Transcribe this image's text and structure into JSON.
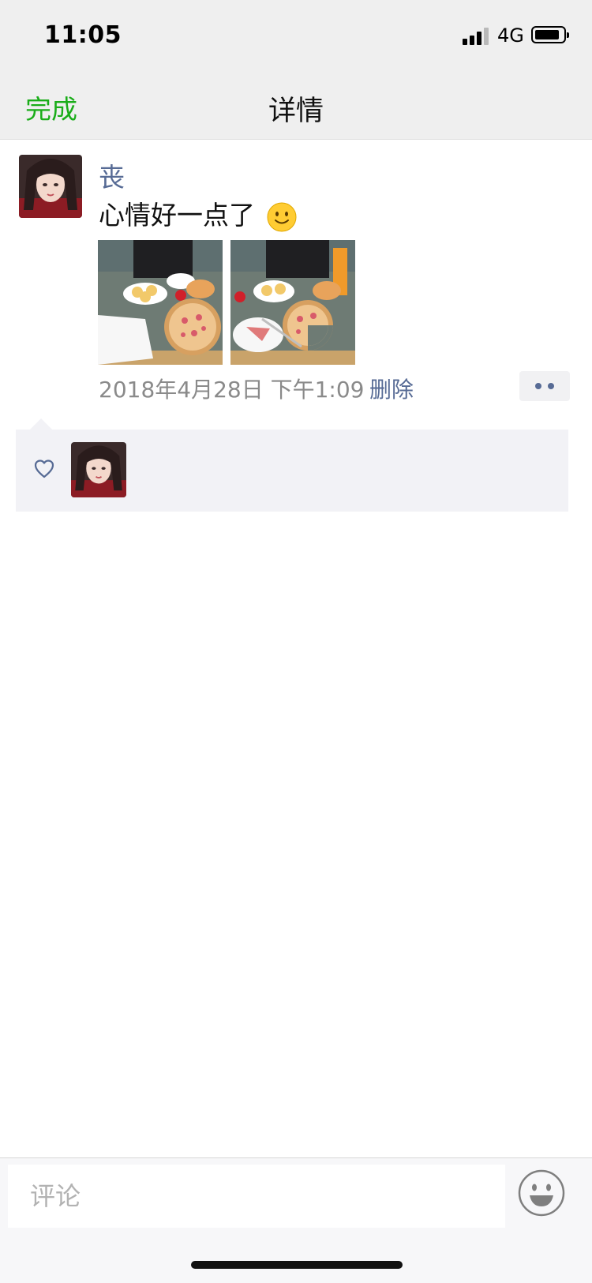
{
  "status_bar": {
    "time": "11:05",
    "network": "4G",
    "icons": [
      "signal-icon",
      "battery-icon"
    ]
  },
  "nav": {
    "done_label": "完成",
    "title": "详情"
  },
  "post": {
    "username": "丧",
    "text": "心情好一点了",
    "emoji": "smile-emoji-icon",
    "photos": [
      "pizza-dinner-photo-1",
      "pizza-dinner-photo-2"
    ],
    "timestamp": "2018年4月28日 下午1:09",
    "delete_label": "删除"
  },
  "likes": {
    "icon": "heart-outline-icon",
    "count": 1
  },
  "comment_bar": {
    "placeholder": "评论",
    "emoji_button_icon": "emoji-face-icon"
  },
  "colors": {
    "accent_green": "#1aad19",
    "link_blue": "#576b95",
    "nav_bg": "#efefef",
    "likes_bg": "#f2f2f6"
  }
}
